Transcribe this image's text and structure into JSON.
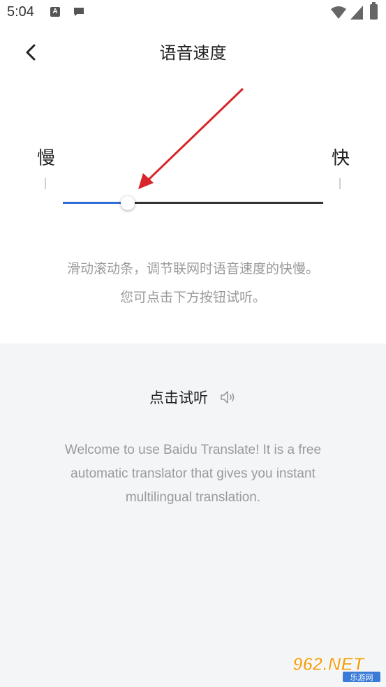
{
  "status_bar": {
    "time": "5:04",
    "icons": [
      "a-notification-icon",
      "message-icon",
      "wifi-icon",
      "signal-icon",
      "battery-icon"
    ]
  },
  "header": {
    "title": "语音速度",
    "back_icon": "chevron-left-icon"
  },
  "speed_slider": {
    "slow_label": "慢",
    "fast_label": "快",
    "value": 0.25,
    "fill_color": "#2f6fd6",
    "track_color": "#333333"
  },
  "hint": {
    "line1": "滑动滚动条，调节联网时语音速度的快慢。",
    "line2": "您可点击下方按钮试听。"
  },
  "preview": {
    "listen_label": "点击试听",
    "speaker_icon": "speaker-icon",
    "sample_text": "Welcome to use Baidu Translate! It is a free automatic translator that gives you instant multilingual translation."
  },
  "watermark": {
    "text": "962.NET",
    "subtext": "乐游网"
  },
  "colors": {
    "accent": "#2f6fd6",
    "panel_bg": "#f4f5f7",
    "annotation": "#d8252a"
  }
}
